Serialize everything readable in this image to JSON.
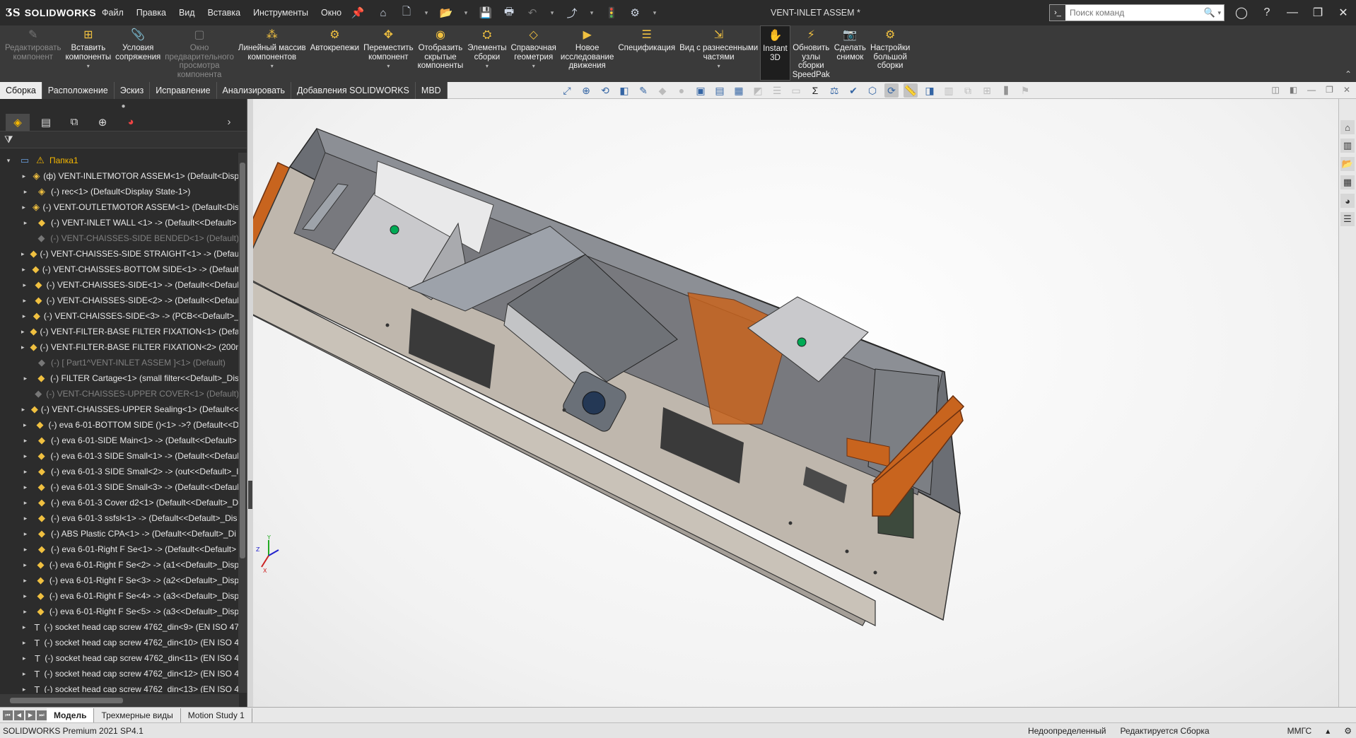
{
  "app": {
    "brand": "SOLIDWORKS",
    "doc_title": "VENT-INLET ASSEM *"
  },
  "menu": [
    "Файл",
    "Правка",
    "Вид",
    "Вставка",
    "Инструменты",
    "Окно"
  ],
  "search": {
    "placeholder": "Поиск команд"
  },
  "ribbon": [
    {
      "label": "Редактировать\nкомпонент",
      "icon": "edit-component-icon",
      "disabled": true,
      "arrow": false
    },
    {
      "label": "Вставить\nкомпоненты",
      "icon": "insert-components-icon",
      "arrow": true
    },
    {
      "label": "Условия\nсопряжения",
      "icon": "mate-icon",
      "arrow": false
    },
    {
      "label": "Окно\nпредварительного\nпросмотра\nкомпонента",
      "icon": "component-preview-icon",
      "disabled": true,
      "arrow": false
    },
    {
      "label": "Линейный массив\nкомпонентов",
      "icon": "linear-pattern-icon",
      "arrow": true
    },
    {
      "label": "Автокрепежи",
      "icon": "smart-fasteners-icon",
      "arrow": false
    },
    {
      "label": "Переместить\nкомпонент",
      "icon": "move-component-icon",
      "arrow": true
    },
    {
      "label": "Отобразить\nскрытые\nкомпоненты",
      "icon": "show-hidden-icon",
      "arrow": false
    },
    {
      "label": "Элементы\nсборки",
      "icon": "assembly-features-icon",
      "arrow": true
    },
    {
      "label": "Справочная\nгеометрия",
      "icon": "reference-geometry-icon",
      "arrow": true
    },
    {
      "label": "Новое\nисследование\nдвижения",
      "icon": "new-motion-study-icon",
      "arrow": false
    },
    {
      "label": "Спецификация",
      "icon": "bom-icon",
      "arrow": false
    },
    {
      "label": "Вид с разнесенными\nчастями",
      "icon": "exploded-view-icon",
      "arrow": true
    },
    {
      "label": "Instant\n3D",
      "icon": "instant3d-icon",
      "active": true,
      "arrow": false
    },
    {
      "label": "Обновить\nузлы\nсборки\nSpeedPak",
      "icon": "speedpak-icon",
      "arrow": false
    },
    {
      "label": "Сделать\nснимок",
      "icon": "snapshot-icon",
      "arrow": false
    },
    {
      "label": "Настройки\nбольшой\nсборки",
      "icon": "large-assembly-icon",
      "arrow": false
    }
  ],
  "command_tabs": [
    "Сборка",
    "Расположение",
    "Эскиз",
    "Исправление",
    "Анализировать",
    "Добавления SOLIDWORKS",
    "MBD"
  ],
  "tree": {
    "root": "Папка1",
    "items": [
      {
        "text": "(ф) VENT-INLETMOTOR ASSEM<1> (Default<Disp",
        "type": "asm"
      },
      {
        "text": "(-) rec<1> (Default<Display State-1>)",
        "type": "asm"
      },
      {
        "text": "(-) VENT-OUTLETMOTOR ASSEM<1> (Default<Dis",
        "type": "asm"
      },
      {
        "text": "(-) VENT-INLET WALL <1> -> (Default<<Default>",
        "type": "part"
      },
      {
        "text": "(-) VENT-CHAISSES-SIDE BENDED<1> (Default)",
        "type": "part",
        "suppressed": true
      },
      {
        "text": "(-) VENT-CHAISSES-SIDE STRAIGHT<1> -> (Defau",
        "type": "part"
      },
      {
        "text": "(-) VENT-CHAISSES-BOTTOM SIDE<1> -> (Default",
        "type": "part"
      },
      {
        "text": "(-) VENT-CHAISSES-SIDE<1> -> (Default<<Defaul",
        "type": "part"
      },
      {
        "text": "(-) VENT-CHAISSES-SIDE<2> -> (Default<<Defaul",
        "type": "part"
      },
      {
        "text": "(-) VENT-CHAISSES-SIDE<3> -> (PCB<<Default>_",
        "type": "part"
      },
      {
        "text": "(-) VENT-FILTER-BASE FILTER FIXATION<1> (Defau",
        "type": "part"
      },
      {
        "text": "(-) VENT-FILTER-BASE FILTER FIXATION<2> (200m",
        "type": "part"
      },
      {
        "text": "(-) [ Part1^VENT-INLET ASSEM ]<1> (Default)",
        "type": "part",
        "suppressed": true
      },
      {
        "text": "(-) FILTER Cartage<1> (small filter<<Default>_Dis",
        "type": "part"
      },
      {
        "text": "(-) VENT-CHAISSES-UPPER COVER<1> (Default)",
        "type": "part",
        "suppressed": true
      },
      {
        "text": "(-) VENT-CHAISSES-UPPER Sealing<1> (Default<<",
        "type": "part"
      },
      {
        "text": "(-) eva 6-01-BOTTOM SIDE ()<1> ->? (Default<<D",
        "type": "part"
      },
      {
        "text": "(-) eva 6-01-SIDE Main<1> -> (Default<<Default>",
        "type": "part"
      },
      {
        "text": "(-) eva 6-01-3 SIDE Small<1> -> (Default<<Defaul",
        "type": "part"
      },
      {
        "text": "(-) eva 6-01-3 SIDE Small<2> -> (out<<Default>_I",
        "type": "part"
      },
      {
        "text": "(-) eva 6-01-3 SIDE Small<3> -> (Default<<Defaul",
        "type": "part"
      },
      {
        "text": "(-) eva 6-01-3 Cover d2<1> (Default<<Default>_D",
        "type": "part"
      },
      {
        "text": "(-) eva 6-01-3 ssfsl<1> -> (Default<<Default>_Dis",
        "type": "part"
      },
      {
        "text": "(-) ABS Plastic CPA<1> -> (Default<<Default>_Di",
        "type": "part"
      },
      {
        "text": "(-) eva 6-01-Right F Se<1> -> (Default<<Default>",
        "type": "part"
      },
      {
        "text": "(-) eva 6-01-Right F Se<2> -> (a1<<Default>_Disp",
        "type": "part"
      },
      {
        "text": "(-) eva 6-01-Right F Se<3> -> (a2<<Default>_Disp",
        "type": "part"
      },
      {
        "text": "(-) eva 6-01-Right F Se<4> -> (a3<<Default>_Disp",
        "type": "part"
      },
      {
        "text": "(-) eva 6-01-Right F Se<5> -> (a3<<Default>_Disp",
        "type": "part"
      },
      {
        "text": "(-) socket head cap screw 4762_din<9> (EN ISO 47",
        "type": "screw"
      },
      {
        "text": "(-) socket head cap screw 4762_din<10> (EN ISO 4",
        "type": "screw"
      },
      {
        "text": "(-) socket head cap screw 4762_din<11> (EN ISO 4",
        "type": "screw"
      },
      {
        "text": "(-) socket head cap screw 4762_din<12> (EN ISO 4",
        "type": "screw"
      },
      {
        "text": "(-) socket head cap screw 4762_din<13> (EN ISO 4",
        "type": "screw"
      }
    ]
  },
  "bottom_tabs": [
    "Модель",
    "Трехмерные виды",
    "Motion Study 1"
  ],
  "status": {
    "product": "SOLIDWORKS Premium 2021 SP4.1",
    "definition": "Недоопределенный",
    "mode": "Редактируется Сборка",
    "units": "ММГС"
  },
  "colors": {
    "orange_handle": "#c8641e",
    "chassis": "#b9b2a9",
    "accent_blue": "#3465a4",
    "warning": "#f5b700"
  }
}
